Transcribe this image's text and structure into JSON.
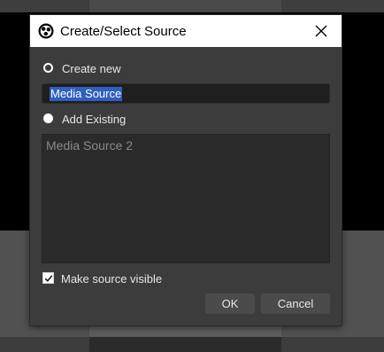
{
  "dialog": {
    "title": "Create/Select Source",
    "create_new_label": "Create new",
    "new_source_name": "Media Source",
    "add_existing_label": "Add Existing",
    "existing_sources": [
      "Media Source 2"
    ],
    "make_visible_label": "Make source visible",
    "make_visible_checked": true,
    "ok_label": "OK",
    "cancel_label": "Cancel"
  }
}
